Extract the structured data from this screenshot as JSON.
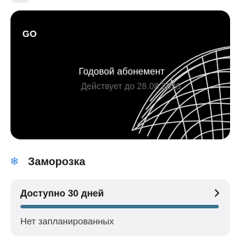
{
  "membership_card": {
    "logo": "GO",
    "title": "Годовой абонемент",
    "valid_until": "Действует до 28.08.2026",
    "background_color": "#000000"
  },
  "freeze_section": {
    "icon": "snowflake-icon",
    "icon_color": "#3b8fe0",
    "title": "Заморозка",
    "available": "Доступно 30 дней",
    "progress_fraction": 1.0,
    "progress_color": "#3d7290",
    "status": "Нет запланированных"
  }
}
